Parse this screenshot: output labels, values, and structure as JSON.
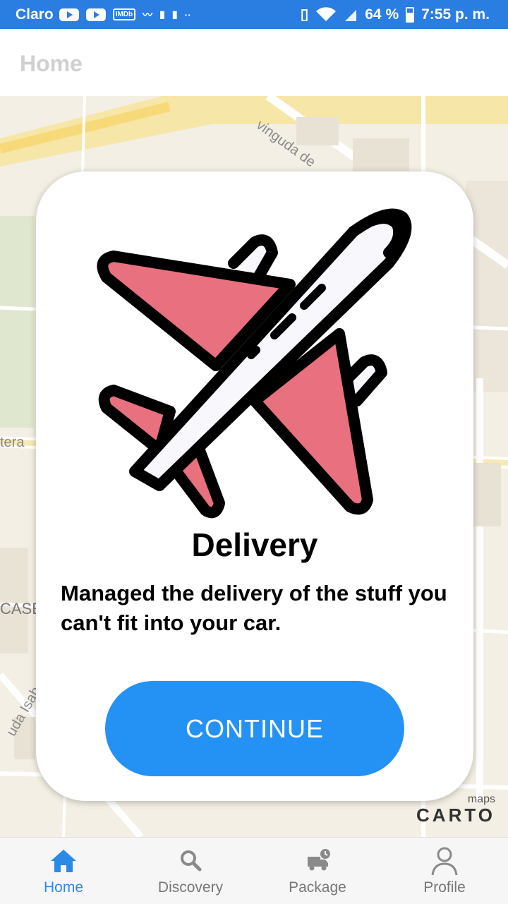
{
  "status_bar": {
    "carrier": "Claro",
    "imdb": "IMDb",
    "dots": "··",
    "battery": "64 %",
    "time": "7:55 p. m."
  },
  "header": {
    "title": "Home"
  },
  "map": {
    "labels": [
      "vinguda de",
      "tera",
      "CASE",
      "uda Isabel"
    ],
    "attribution": {
      "maps": "maps",
      "carto": "CARTO"
    }
  },
  "card": {
    "title": "Delivery",
    "description": "Managed the delivery of the stuff you can't fit into your car.",
    "button": "CONTINUE",
    "illustration_icon": "airplane-icon",
    "colors": {
      "wing": "#e8707f",
      "body": "#f7f7fc",
      "outline": "#000000"
    }
  },
  "bottom_nav": {
    "items": [
      {
        "label": "Home",
        "icon": "home-icon",
        "active": true
      },
      {
        "label": "Discovery",
        "icon": "search-icon",
        "active": false
      },
      {
        "label": "Package",
        "icon": "truck-icon",
        "active": false
      },
      {
        "label": "Profile",
        "icon": "person-icon",
        "active": false
      }
    ]
  },
  "colors": {
    "status_bar": "#2a7de1",
    "accent": "#2492f5",
    "active_nav": "#2a8ae8"
  }
}
